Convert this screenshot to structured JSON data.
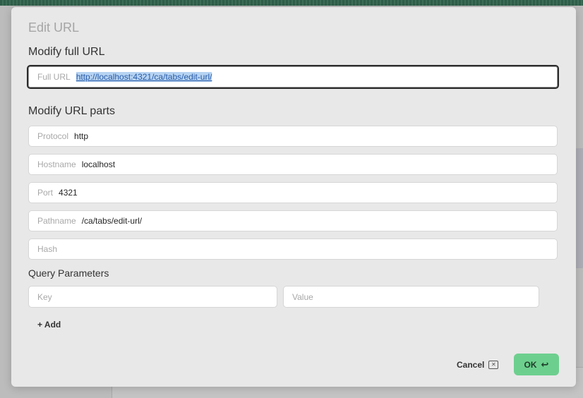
{
  "dialog": {
    "title": "Edit URL",
    "full_url_section": "Modify full URL",
    "parts_section": "Modify URL parts",
    "query_section": "Query Parameters"
  },
  "full_url": {
    "label": "Full URL",
    "value": "http://localhost:4321/ca/tabs/edit-url/"
  },
  "parts": {
    "protocol": {
      "label": "Protocol",
      "value": "http"
    },
    "hostname": {
      "label": "Hostname",
      "value": "localhost"
    },
    "port": {
      "label": "Port",
      "value": "4321"
    },
    "pathname": {
      "label": "Pathname",
      "value": "/ca/tabs/edit-url/"
    },
    "hash": {
      "label": "Hash",
      "value": ""
    }
  },
  "query": {
    "key_placeholder": "Key",
    "value_placeholder": "Value",
    "add_label": "+ Add"
  },
  "actions": {
    "cancel_label": "Cancel",
    "cancel_key": "✕",
    "ok_label": "OK",
    "ok_key": "↩"
  }
}
